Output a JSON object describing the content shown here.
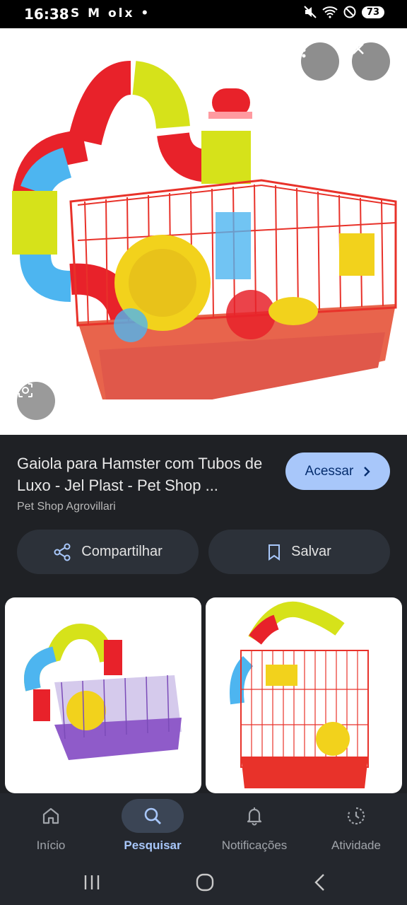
{
  "status_bar": {
    "time": "16:38",
    "app_indicators": "S M olx •",
    "battery": "73"
  },
  "viewer": {
    "more_icon": "vertical-dots-icon",
    "close_icon": "close-icon",
    "lens_icon": "lens-icon"
  },
  "result": {
    "title": "Gaiola para Hamster com Tubos de Luxo - Jel Plast - Pet Shop ...",
    "source": "Pet Shop Agrovillari",
    "visit_label": "Acessar",
    "share_label": "Compartilhar",
    "save_label": "Salvar"
  },
  "bottom_nav": {
    "items": [
      {
        "label": "Início",
        "icon": "home-icon"
      },
      {
        "label": "Pesquisar",
        "icon": "search-icon"
      },
      {
        "label": "Notificações",
        "icon": "bell-icon"
      },
      {
        "label": "Atividade",
        "icon": "activity-icon"
      }
    ],
    "active": "Pesquisar"
  },
  "colors": {
    "accent": "#a8c7fa",
    "background": "#1f2125",
    "button_bg": "#2c3139"
  }
}
